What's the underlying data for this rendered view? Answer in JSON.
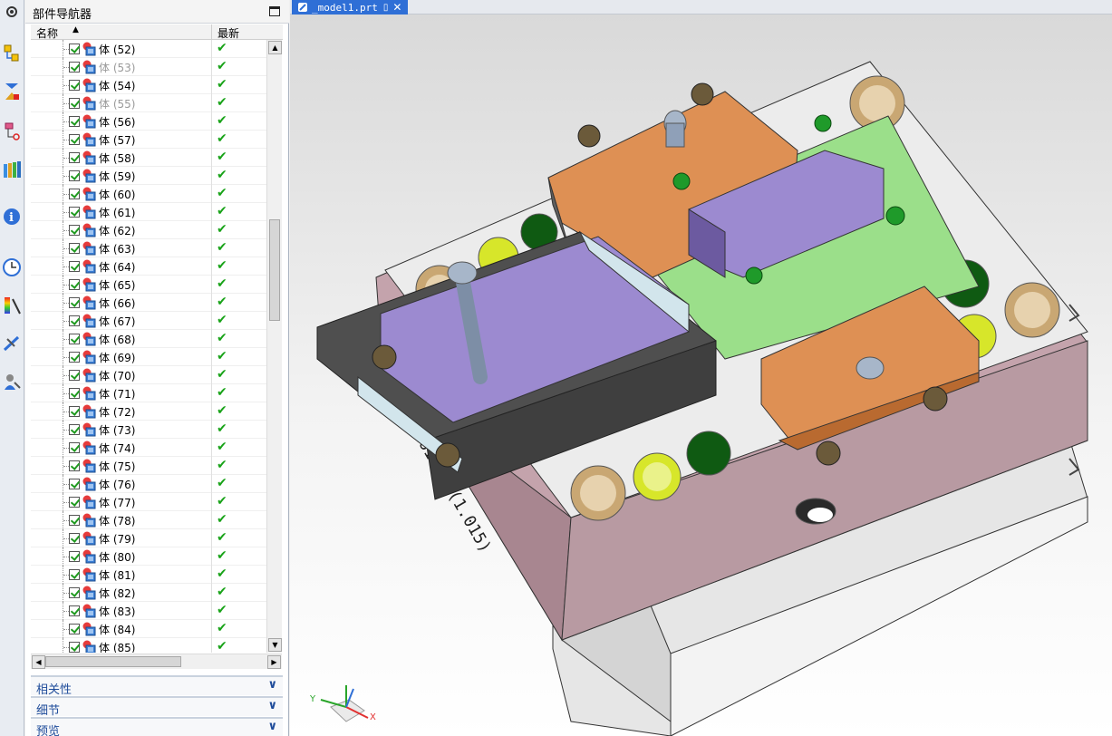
{
  "navigator": {
    "title": "部件导航器",
    "col_name": "名称",
    "col_latest": "最新",
    "rows": [
      {
        "label": "体 (52)",
        "dim": false
      },
      {
        "label": "体 (53)",
        "dim": true
      },
      {
        "label": "体 (54)",
        "dim": false
      },
      {
        "label": "体 (55)",
        "dim": true
      },
      {
        "label": "体 (56)",
        "dim": false
      },
      {
        "label": "体 (57)",
        "dim": false
      },
      {
        "label": "体 (58)",
        "dim": false
      },
      {
        "label": "体 (59)",
        "dim": false
      },
      {
        "label": "体 (60)",
        "dim": false
      },
      {
        "label": "体 (61)",
        "dim": false
      },
      {
        "label": "体 (62)",
        "dim": false
      },
      {
        "label": "体 (63)",
        "dim": false
      },
      {
        "label": "体 (64)",
        "dim": false
      },
      {
        "label": "体 (65)",
        "dim": false
      },
      {
        "label": "体 (66)",
        "dim": false
      },
      {
        "label": "体 (67)",
        "dim": false
      },
      {
        "label": "体 (68)",
        "dim": false
      },
      {
        "label": "体 (69)",
        "dim": false
      },
      {
        "label": "体 (70)",
        "dim": false
      },
      {
        "label": "体 (71)",
        "dim": false
      },
      {
        "label": "体 (72)",
        "dim": false
      },
      {
        "label": "体 (73)",
        "dim": false
      },
      {
        "label": "体 (74)",
        "dim": false
      },
      {
        "label": "体 (75)",
        "dim": false
      },
      {
        "label": "体 (76)",
        "dim": false
      },
      {
        "label": "体 (77)",
        "dim": false
      },
      {
        "label": "体 (78)",
        "dim": false
      },
      {
        "label": "体 (79)",
        "dim": false
      },
      {
        "label": "体 (80)",
        "dim": false
      },
      {
        "label": "体 (81)",
        "dim": false
      },
      {
        "label": "体 (82)",
        "dim": false
      },
      {
        "label": "体 (83)",
        "dim": false
      },
      {
        "label": "体 (84)",
        "dim": false
      },
      {
        "label": "体 (85)",
        "dim": false
      }
    ],
    "sections": [
      "相关性",
      "细节",
      "预览"
    ]
  },
  "tab": {
    "label": "_model1.prt"
  },
  "model": {
    "engraving": "12-161-1-8(1.015)"
  },
  "triad": {
    "x": "X",
    "y": "Y"
  },
  "colors": {
    "accent": "#2f6fd6",
    "check_green": "#19a319"
  },
  "rail_icons": [
    "settings-icon",
    "assembly-navigator-icon",
    "constraint-navigator-icon",
    "part-navigator-icon",
    "reuse-library-icon",
    "web-browser-icon",
    "history-icon",
    "visualization-icon",
    "system-materials-icon",
    "roles-icon"
  ]
}
